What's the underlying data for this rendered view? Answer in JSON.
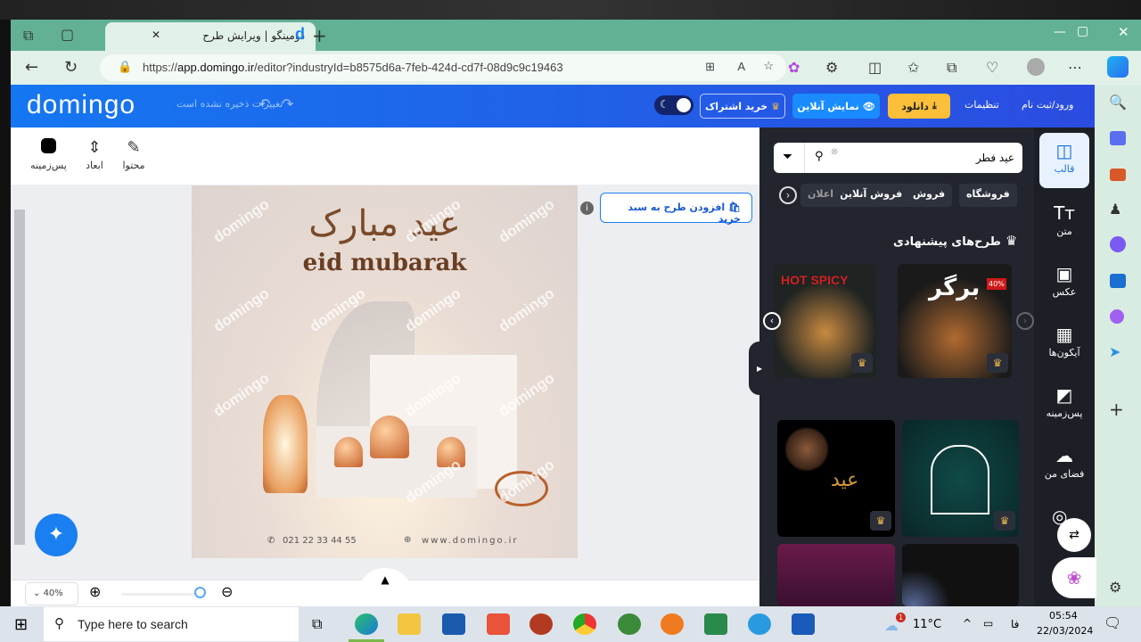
{
  "browser": {
    "tab_title": "دومینگو | ویرایش طرح",
    "url_scheme": "https://",
    "url_host": "app.domingo.ir",
    "url_path": "/editor?industryId=b8575d6a-7feb-424d-cd7f-08d9c9c19463"
  },
  "header": {
    "logo": "domingo",
    "save_status": "تغییرات ذخیره نشده است",
    "login": "ورود/ثبت نام",
    "settings": "تنظیمات",
    "download": "دانلود",
    "preview": "نمایش آنلاین",
    "subscribe": "خرید اشتراک",
    "colors": {
      "header": "#1577f2",
      "download": "#fbbf3a",
      "preview": "#1a8cff"
    }
  },
  "toolbar": {
    "items": [
      {
        "label": "محتوا",
        "icon": "pencil-icon"
      },
      {
        "label": "ابعاد",
        "icon": "resize-icon"
      },
      {
        "label": "پس‌زمینه",
        "icon": "background-color-icon"
      }
    ]
  },
  "canvas": {
    "add_to_cart": "افزودن طرح به سبد خرید",
    "design": {
      "title_ar": "عید مبارک",
      "title_en": "eid mubarak",
      "phone": "021 22 33 44 55",
      "website": "www.domingo.ir",
      "watermark": "domingo"
    },
    "zoom_level": "40%",
    "zoom_slider_percent": 100
  },
  "panel": {
    "search_value": "عید فطر",
    "chips": [
      "فروشگاه",
      "فروش",
      "فروش آنلاین",
      "اعلان"
    ],
    "suggested_title": "طرح‌های پیشنهادی",
    "suggested": [
      {
        "title": "برگر",
        "badge": "40%"
      },
      {
        "title": "HOT SPICY"
      }
    ]
  },
  "rail": {
    "items": [
      {
        "label": "قالب",
        "icon": "template-icon"
      },
      {
        "label": "متن",
        "icon": "text-icon"
      },
      {
        "label": "عکس",
        "icon": "image-icon"
      },
      {
        "label": "آیکون‌ها",
        "icon": "icons-grid-icon"
      },
      {
        "label": "پس‌زمینه",
        "icon": "background-icon"
      },
      {
        "label": "فضای من",
        "icon": "cloud-upload-icon"
      }
    ]
  },
  "taskbar": {
    "search_placeholder": "Type here to search",
    "weather": "11°C",
    "weather_badge": "1",
    "lang": "فا",
    "time": "05:54",
    "date": "22/03/2024"
  }
}
